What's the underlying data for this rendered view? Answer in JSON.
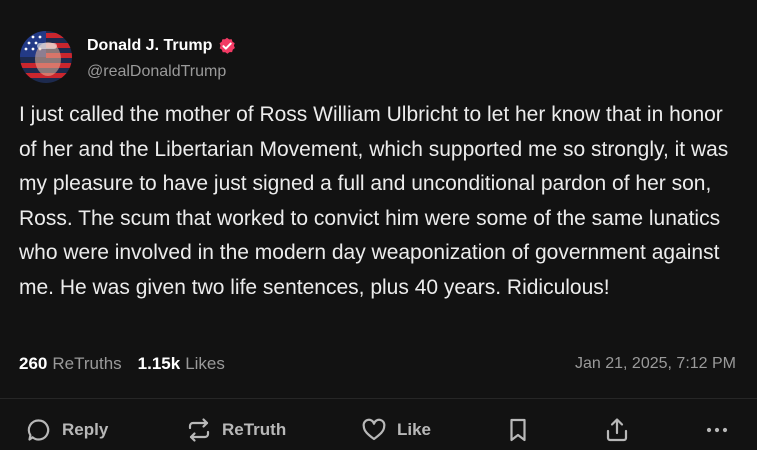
{
  "author": {
    "display_name": "Donald J. Trump",
    "handle": "@realDonaldTrump",
    "verified_color": "#f23a64"
  },
  "post": {
    "text": "I just called the mother of Ross William Ulbricht to let her know that in honor of her and the Libertarian Movement, which supported me so strongly, it was my pleasure to have just signed a full and unconditional pardon of her son, Ross. The scum that worked to convict him were some of the same lunatics who were involved in the modern day weaponization of government against me. He was given two life sentences, plus 40 years. Ridiculous!",
    "retruths_count": "260",
    "retruths_label": "ReTruths",
    "likes_count": "1.15k",
    "likes_label": "Likes",
    "timestamp": "Jan 21, 2025, 7:12 PM"
  },
  "actions": {
    "reply_label": "Reply",
    "retruth_label": "ReTruth",
    "like_label": "Like"
  },
  "icons": [
    "reply-icon",
    "retruth-icon",
    "heart-icon",
    "bookmark-icon",
    "share-icon",
    "more-icon",
    "verified-badge-icon"
  ],
  "colors": {
    "background": "#121212",
    "text_primary": "#ececec",
    "text_secondary": "#9a9a9a",
    "action_color": "#b8b8b8"
  }
}
